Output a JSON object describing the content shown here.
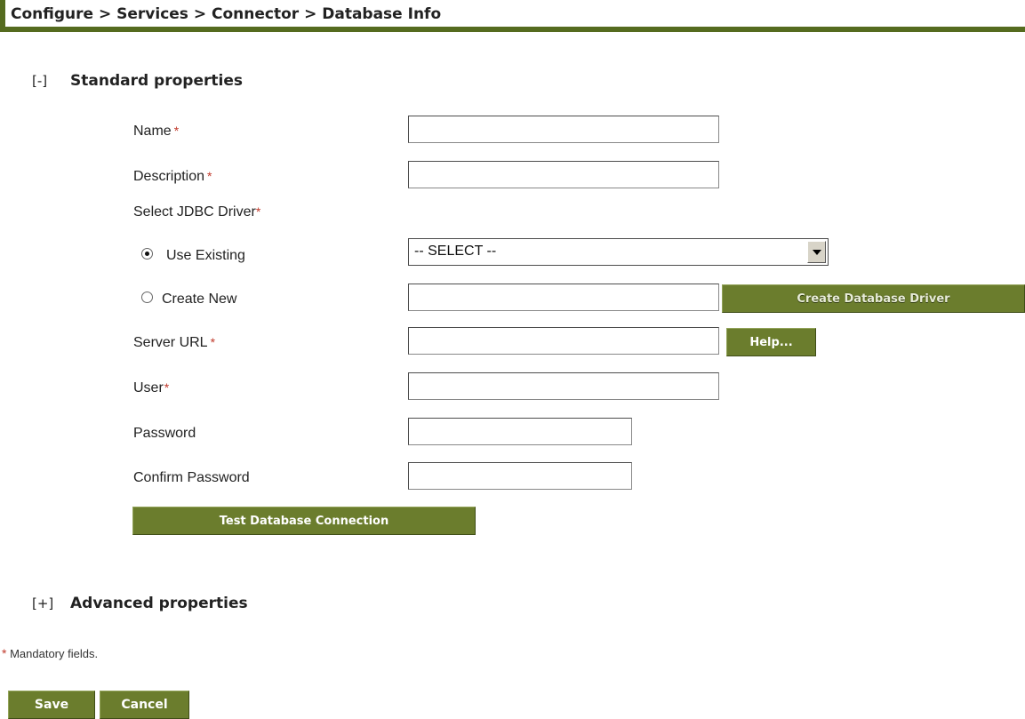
{
  "breadcrumb": "Configure > Services > Connector > Database Info",
  "standard": {
    "toggle": "[-]",
    "title": "Standard properties"
  },
  "advanced": {
    "toggle": "[+]",
    "title": "Advanced properties"
  },
  "fields": {
    "name": {
      "label": "Name",
      "value": ""
    },
    "description": {
      "label": "Description",
      "value": ""
    },
    "jdbc_label": "Select JDBC Driver",
    "use_existing": {
      "label": "Use Existing",
      "selected": true
    },
    "select_value": "-- SELECT --",
    "create_new": {
      "label": "Create New",
      "selected": false,
      "value": ""
    },
    "server_url": {
      "label": "Server URL",
      "value": ""
    },
    "user": {
      "label": "User",
      "value": ""
    },
    "password": {
      "label": "Password",
      "value": ""
    },
    "confirm_password": {
      "label": "Confirm Password",
      "value": ""
    }
  },
  "required_marker": "*",
  "buttons": {
    "create_driver": "Create Database Driver",
    "help": "Help...",
    "test_connection": "Test Database Connection",
    "save": "Save",
    "cancel": "Cancel"
  },
  "footnote": "Mandatory fields.",
  "colors": {
    "accent": "#6b7d2d",
    "rule": "#556b1f",
    "required": "#c0392b"
  }
}
